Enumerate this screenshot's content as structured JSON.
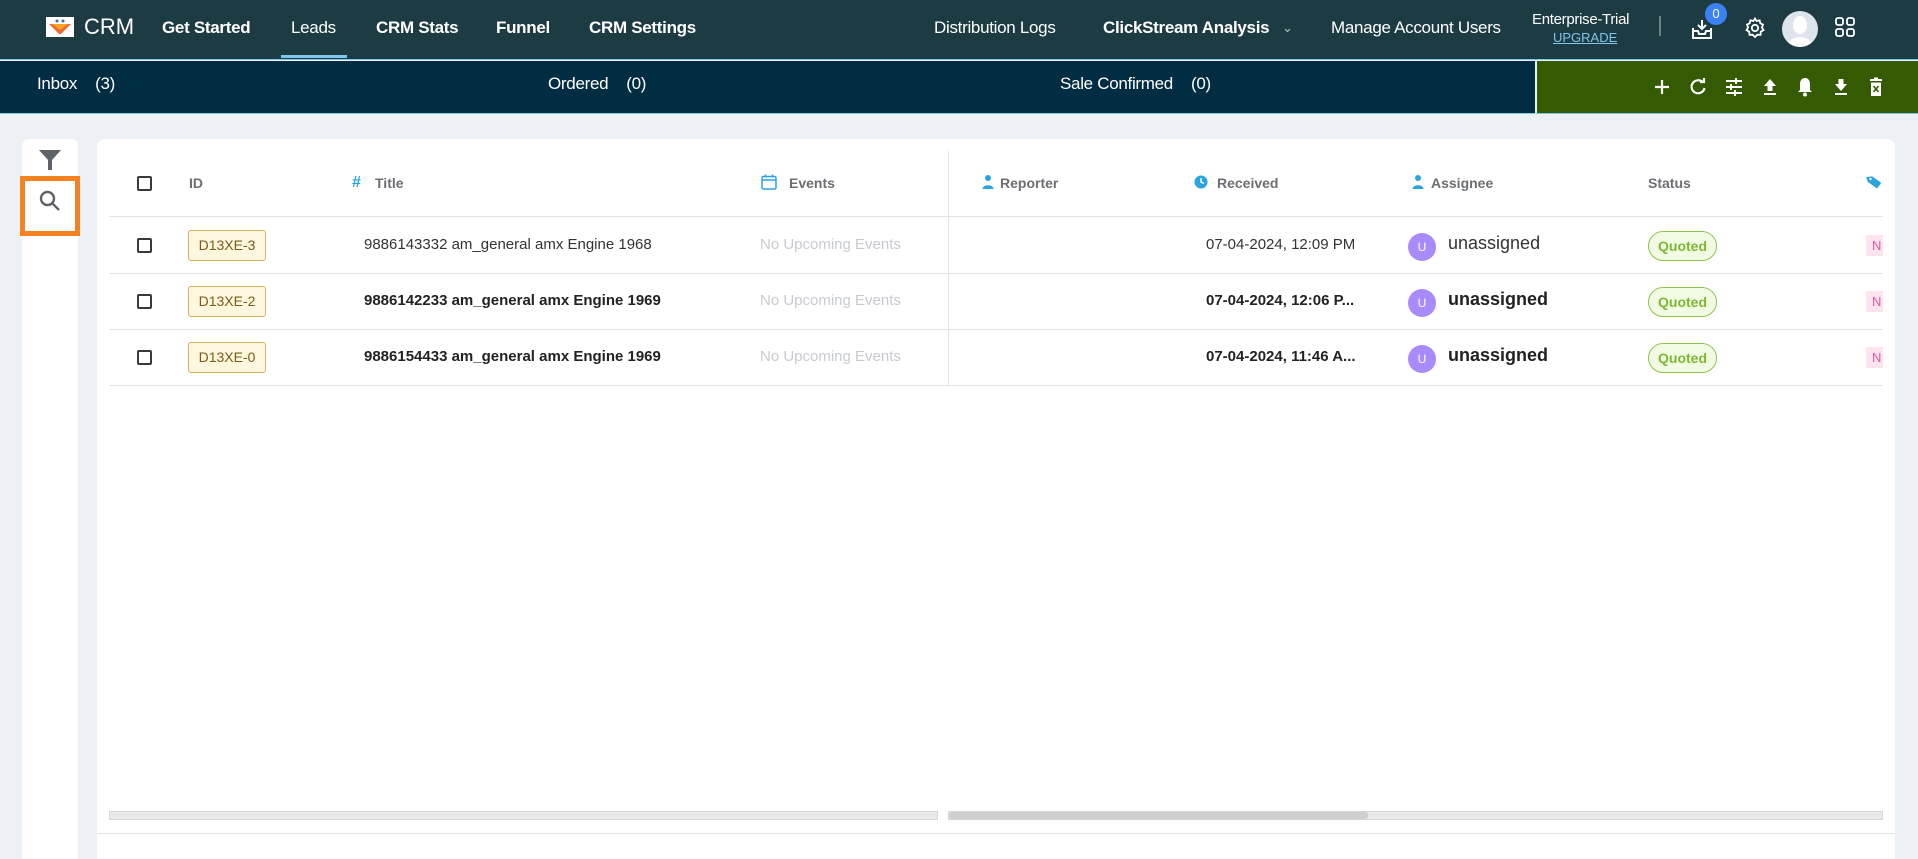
{
  "app": {
    "brand": "CRM"
  },
  "nav": {
    "items": [
      {
        "label": "Get Started",
        "active": false
      },
      {
        "label": "Leads",
        "active": true
      },
      {
        "label": "CRM Stats",
        "active": false
      },
      {
        "label": "Funnel",
        "active": false
      },
      {
        "label": "CRM Settings",
        "active": false
      }
    ],
    "right_items": [
      {
        "label": "Distribution Logs"
      },
      {
        "label": "ClickStream Analysis",
        "has_dropdown": true
      },
      {
        "label": "Manage Account Users"
      }
    ],
    "plan": "Enterprise-Trial",
    "upgrade_label": "UPGRADE",
    "inbox_badge": "0",
    "icons": [
      "inbox-download-icon",
      "gear-icon",
      "avatar",
      "apps-grid-icon"
    ]
  },
  "subtabs": [
    {
      "label": "Inbox",
      "count": "(3)"
    },
    {
      "label": "Ordered",
      "count": "(0)"
    },
    {
      "label": "Sale Confirmed",
      "count": "(0)"
    }
  ],
  "actions": [
    "add-icon",
    "refresh-icon",
    "tune-icon",
    "upload-icon",
    "bell-icon",
    "download-icon",
    "delete-icon"
  ],
  "colors": {
    "topnav": "#1d3b43",
    "subbar": "#012d43",
    "actionbar": "#345a02",
    "accent": "#7fc7ea",
    "highlight": "#f58220",
    "status_green": "#7fb733"
  },
  "table": {
    "columns": [
      {
        "label": "ID"
      },
      {
        "label": "Title",
        "icon": "hash-icon"
      },
      {
        "label": "Events",
        "icon": "calendar-icon"
      },
      {
        "label": "Reporter",
        "icon": "person-icon"
      },
      {
        "label": "Received",
        "icon": "clock-icon"
      },
      {
        "label": "Assignee",
        "icon": "person-icon"
      },
      {
        "label": "Status"
      },
      {
        "label": "",
        "icon": "tag-icon"
      }
    ],
    "rows": [
      {
        "id": "D13XE-3",
        "title": "9886143332 am_general amx Engine 1968",
        "events": "No Upcoming Events",
        "reporter": "",
        "received": "07-04-2024, 12:09 PM",
        "assignee_initial": "U",
        "assignee": "unassigned",
        "status": "Quoted",
        "tag": "N",
        "unread": false
      },
      {
        "id": "D13XE-2",
        "title": "9886142233 am_general amx Engine 1969",
        "events": "No Upcoming Events",
        "reporter": "",
        "received": "07-04-2024, 12:06 P...",
        "assignee_initial": "U",
        "assignee": "unassigned",
        "status": "Quoted",
        "tag": "N",
        "unread": true
      },
      {
        "id": "D13XE-0",
        "title": "9886154433 am_general amx Engine 1969",
        "events": "No Upcoming Events",
        "reporter": "",
        "received": "07-04-2024, 11:46 A...",
        "assignee_initial": "U",
        "assignee": "unassigned",
        "status": "Quoted",
        "tag": "N",
        "unread": true
      }
    ]
  }
}
